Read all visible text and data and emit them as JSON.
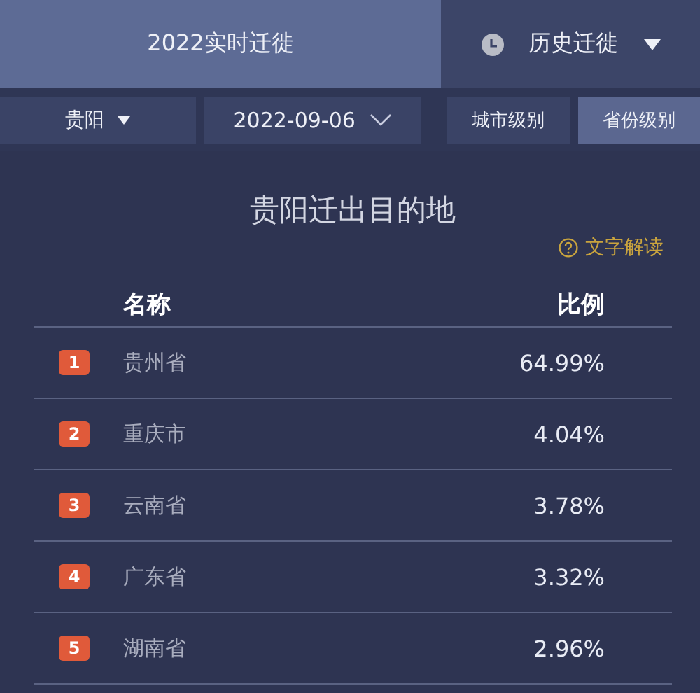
{
  "mode_tabs": [
    {
      "label": "2022实时迁徙",
      "kind": "plain",
      "selected": true
    },
    {
      "label": "历史迁徙",
      "kind": "history",
      "selected": false
    }
  ],
  "filters": {
    "city": "贵阳",
    "date": "2022-09-06"
  },
  "level_tabs": [
    {
      "label": "城市级别",
      "selected": false
    },
    {
      "label": "省份级别",
      "selected": true
    }
  ],
  "panel": {
    "title": "贵阳迁出目的地",
    "help_link": "文字解读",
    "columns": [
      "名称",
      "比例"
    ],
    "rows": [
      {
        "rank": "1",
        "name": "贵州省",
        "share": "64.99%"
      },
      {
        "rank": "2",
        "name": "重庆市",
        "share": "4.04%"
      },
      {
        "rank": "3",
        "name": "云南省",
        "share": "3.78%"
      },
      {
        "rank": "4",
        "name": "广东省",
        "share": "3.32%"
      },
      {
        "rank": "5",
        "name": "湖南省",
        "share": "2.96%"
      }
    ]
  }
}
